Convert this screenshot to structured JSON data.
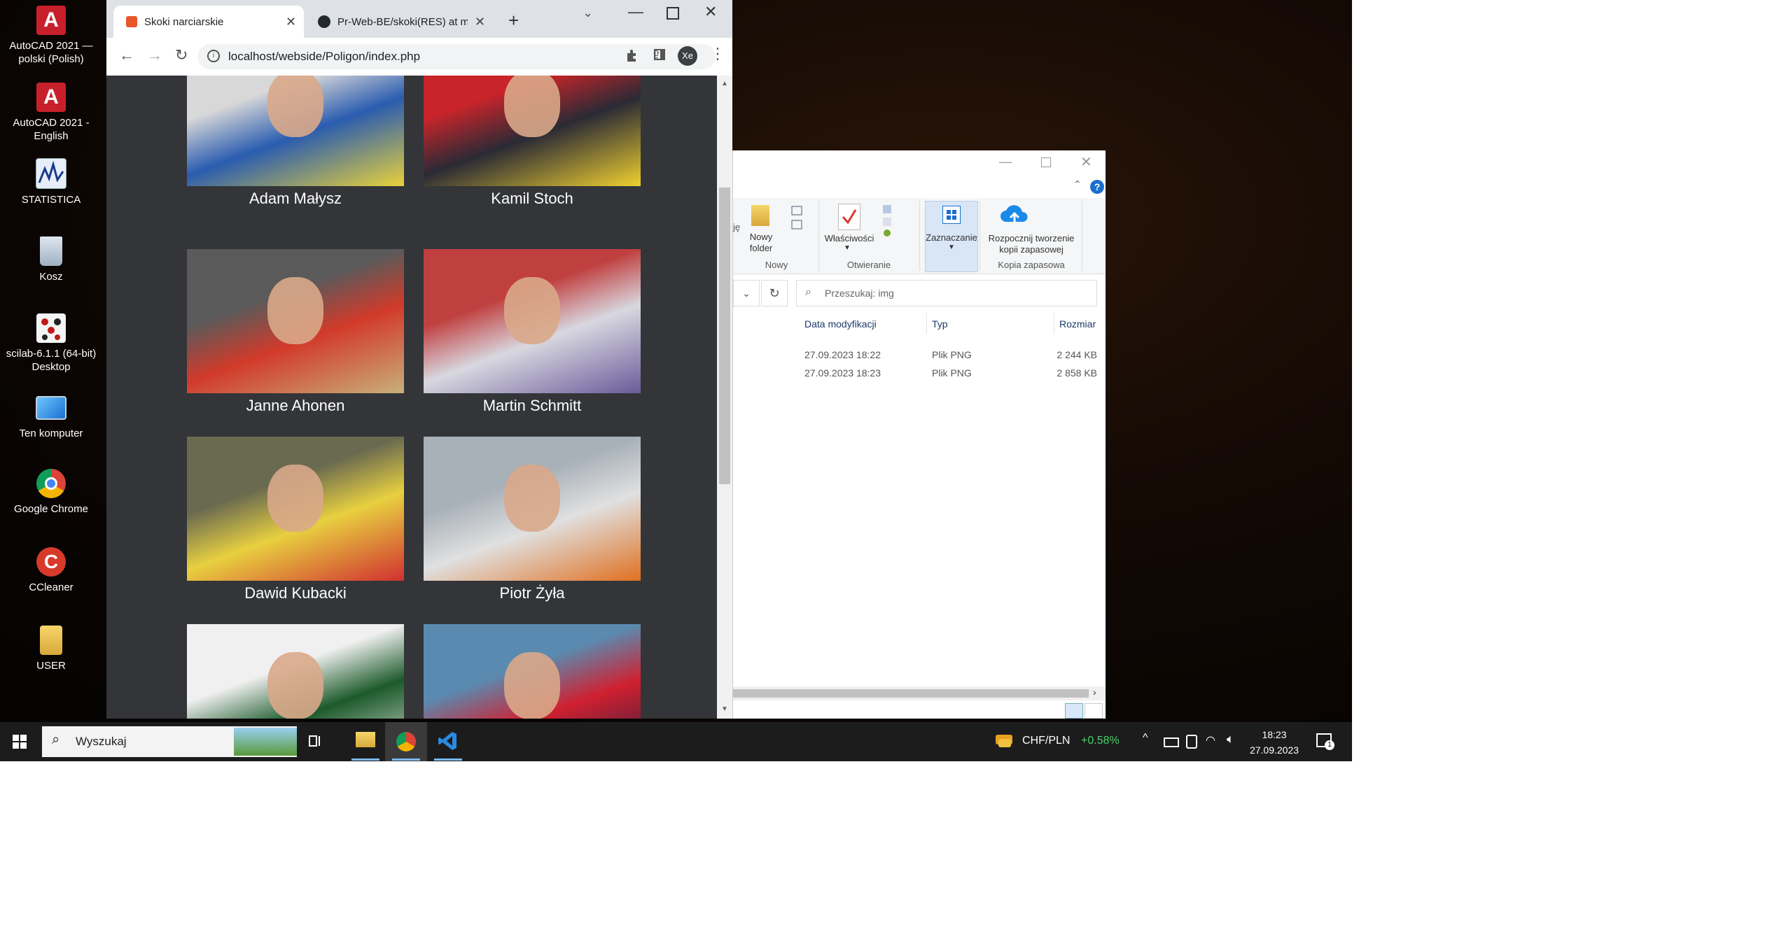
{
  "desktop_icons": [
    {
      "label": "AutoCAD 2021 — polski (Polish)",
      "icon": "autocad-icon"
    },
    {
      "label": "AutoCAD 2021 - English",
      "icon": "autocad-icon"
    },
    {
      "label": "STATISTICA",
      "icon": "statistica-icon"
    },
    {
      "label": "Kosz",
      "icon": "recycle-bin-icon"
    },
    {
      "label": "scilab-6.1.1 (64-bit) Desktop",
      "icon": "scilab-icon"
    },
    {
      "label": "Ten komputer",
      "icon": "computer-icon"
    },
    {
      "label": "Google Chrome",
      "icon": "chrome-icon"
    },
    {
      "label": "CCleaner",
      "icon": "ccleaner-icon"
    },
    {
      "label": "USER",
      "icon": "user-folder-icon"
    }
  ],
  "browser": {
    "tabs": [
      {
        "title": "Skoki narciarskie",
        "active": true
      },
      {
        "title": "Pr-Web-BE/skoki(RES) at ma",
        "active": false
      }
    ],
    "new_tab": "+",
    "url": "localhost/webside/Poligon/index.php",
    "profile": "Xe",
    "jumpers": [
      {
        "name": "Adam Małysz",
        "colors": [
          "#d8d8d8",
          "#2a5cb0",
          "#e9d23a"
        ]
      },
      {
        "name": "Kamil Stoch",
        "colors": [
          "#c8242a",
          "#2a2a35",
          "#f0d030"
        ]
      },
      {
        "name": "Janne Ahonen",
        "colors": [
          "#5a5a5a",
          "#d23a2a",
          "#c8b07a"
        ]
      },
      {
        "name": "Martin Schmitt",
        "colors": [
          "#c04040",
          "#d8d8e0",
          "#6a5a9a"
        ]
      },
      {
        "name": "Dawid Kubacki",
        "colors": [
          "#6a6a50",
          "#e8d040",
          "#d03030"
        ]
      },
      {
        "name": "Piotr Żyła",
        "colors": [
          "#a8b0b8",
          "#e0e0e0",
          "#e07020"
        ]
      },
      {
        "name": "",
        "colors": [
          "#f0f0f0",
          "#1c5a2a",
          "#e6e6e6"
        ]
      },
      {
        "name": "",
        "colors": [
          "#5a8ab0",
          "#d02030",
          "#202040"
        ]
      }
    ]
  },
  "explorer": {
    "ribbon": {
      "new_folder": "Nowy folder",
      "group_new": "Nowy",
      "properties": "Właściwości",
      "group_open": "Otwieranie",
      "select": "Zaznaczanie",
      "backup": "Rozpocznij tworzenie kopii zapasowej",
      "group_backup": "Kopia zapasowa",
      "cut_label": "ję"
    },
    "search_placeholder": "Przeszukaj: img",
    "columns": {
      "modified": "Data modyfikacji",
      "type": "Typ",
      "size": "Rozmiar"
    },
    "rows": [
      {
        "modified": "27.09.2023 18:22",
        "type": "Plik PNG",
        "size": "2 244 KB"
      },
      {
        "modified": "27.09.2023 18:23",
        "type": "Plik PNG",
        "size": "2 858 KB"
      }
    ]
  },
  "taskbar": {
    "search": "Wyszukaj",
    "currency": "CHF/PLN",
    "currency_change": "+0.58%",
    "time": "18:23",
    "date": "27.09.2023",
    "notifications": "1"
  }
}
